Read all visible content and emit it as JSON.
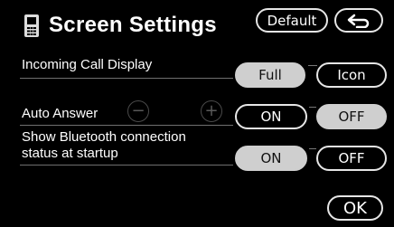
{
  "header": {
    "title": "Screen Settings",
    "icon": "phone-icon",
    "default_label": "Default",
    "back_icon": "back-arrow-icon"
  },
  "settings": {
    "incoming_call_display": {
      "label": "Incoming Call Display",
      "options": [
        "Full",
        "Icon"
      ],
      "selected": "Full"
    },
    "auto_answer": {
      "label": "Auto Answer",
      "decrease_symbol": "−",
      "increase_symbol": "+",
      "options": [
        "ON",
        "OFF"
      ],
      "selected": "OFF"
    },
    "bluetooth_status": {
      "label_line1": "Show Bluetooth connection",
      "label_line2": "status at startup",
      "options": [
        "ON",
        "OFF"
      ],
      "selected": "ON"
    }
  },
  "footer": {
    "ok_label": "OK"
  },
  "colors": {
    "background": "#000000",
    "text": "#ffffff",
    "selected_fill": "#cfcfcf",
    "border": "#e6e6e6"
  }
}
